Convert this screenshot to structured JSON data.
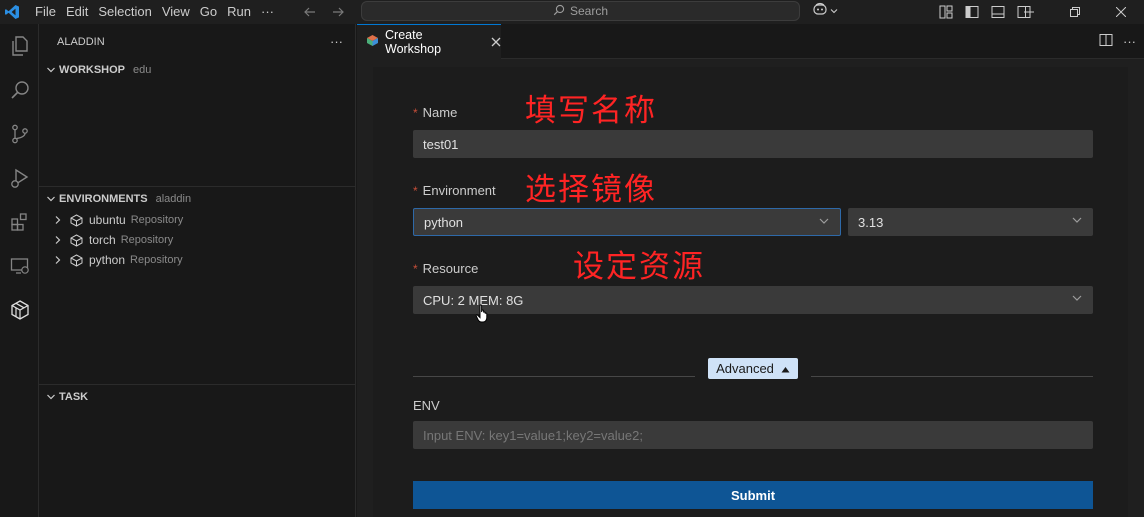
{
  "titlebar": {
    "menu": [
      "File",
      "Edit",
      "Selection",
      "View",
      "Go",
      "Run",
      "···"
    ],
    "search_label": "Search"
  },
  "sidebar": {
    "title": "ALADDIN",
    "more": "···",
    "workshop": {
      "title": "WORKSHOP",
      "desc": "edu"
    },
    "environments": {
      "title": "ENVIRONMENTS",
      "desc": "aladdin",
      "items": [
        {
          "label": "ubuntu",
          "desc": "Repository"
        },
        {
          "label": "torch",
          "desc": "Repository"
        },
        {
          "label": "python",
          "desc": "Repository"
        }
      ]
    },
    "task": {
      "title": "TASK"
    }
  },
  "editor": {
    "tab_title": "Create Workshop",
    "form": {
      "name_label": "Name",
      "name_value": "test01",
      "environment_label": "Environment",
      "environment_value": "python",
      "version_value": "3.13",
      "resource_label": "Resource",
      "resource_value": "CPU: 2 MEM: 8G",
      "advanced_label": "Advanced",
      "env_label": "ENV",
      "env_placeholder": "Input ENV: key1=value1;key2=value2;",
      "submit_label": "Submit"
    },
    "annotations": {
      "fill_name": "填写名称",
      "choose_image": "选择镜像",
      "set_resource": "设定资源"
    }
  },
  "colors": {
    "accent": "#0078d4",
    "submit": "#0e5595",
    "annotation": "#ff2424",
    "required": "#c74e39",
    "advanced_bg": "#cfe2f7"
  }
}
